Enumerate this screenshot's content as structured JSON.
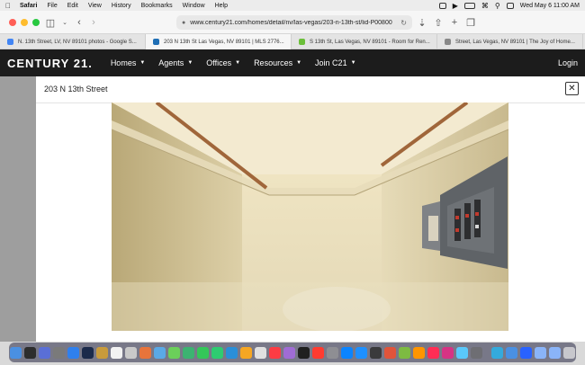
{
  "menubar": {
    "items": [
      "Safari",
      "File",
      "Edit",
      "View",
      "History",
      "Bookmarks",
      "Window",
      "Help"
    ],
    "clock": "Wed May 6  11:00 AM"
  },
  "toolbar": {
    "url": "www.century21.com/homes/detail/nv/las-vegas/203-n-13th-st/lid-P00800"
  },
  "tabs": [
    {
      "label": "N. 13th Street, LV, NV 89101 photos - Google S...",
      "color": "#4285f4",
      "active": false
    },
    {
      "label": "203 N 13th St Las Vegas, NV 89101 | MLS 2776...",
      "color": "#1f6fb5",
      "active": true
    },
    {
      "label": "S 13th St, Las Vegas, NV 89101 - Room for Ren...",
      "color": "#6bbf3a",
      "active": false
    },
    {
      "label": "Street, Las Vegas, NV 89101 | The Joy of Home...",
      "color": "#888888",
      "active": false
    }
  ],
  "site": {
    "logo": "CENTURY 21.",
    "nav": [
      "Homes",
      "Agents",
      "Offices",
      "Resources",
      "Join C21"
    ],
    "login": "Login"
  },
  "modal": {
    "title": "203 N 13th Street",
    "close": "✕"
  },
  "dock_colors": [
    "#4a90e2",
    "#2d2d2d",
    "#5a6fd6",
    "#7a7a7a",
    "#2f80ed",
    "#1b2a4a",
    "#c89b3c",
    "#f2f2f2",
    "#c9c9c9",
    "#e8743b",
    "#5aa9e6",
    "#6bcf5a",
    "#3cb371",
    "#34c759",
    "#2ecc71",
    "#2a8fd8",
    "#f5a623",
    "#e0e0e0",
    "#fc3c44",
    "#a06cd5",
    "#1f1f1f",
    "#ff3b30",
    "#8e8e93",
    "#0a84ff",
    "#1e90ff",
    "#3a3a3c",
    "#e0543b",
    "#7dbb42",
    "#ff9500",
    "#ff2d55",
    "#d63384",
    "#5ac8fa",
    "#6e6e73",
    "#34aadc",
    "#4a90e2",
    "#2962ff",
    "#8ab4f8",
    "#8ab4f8",
    "#c7c7cc"
  ]
}
